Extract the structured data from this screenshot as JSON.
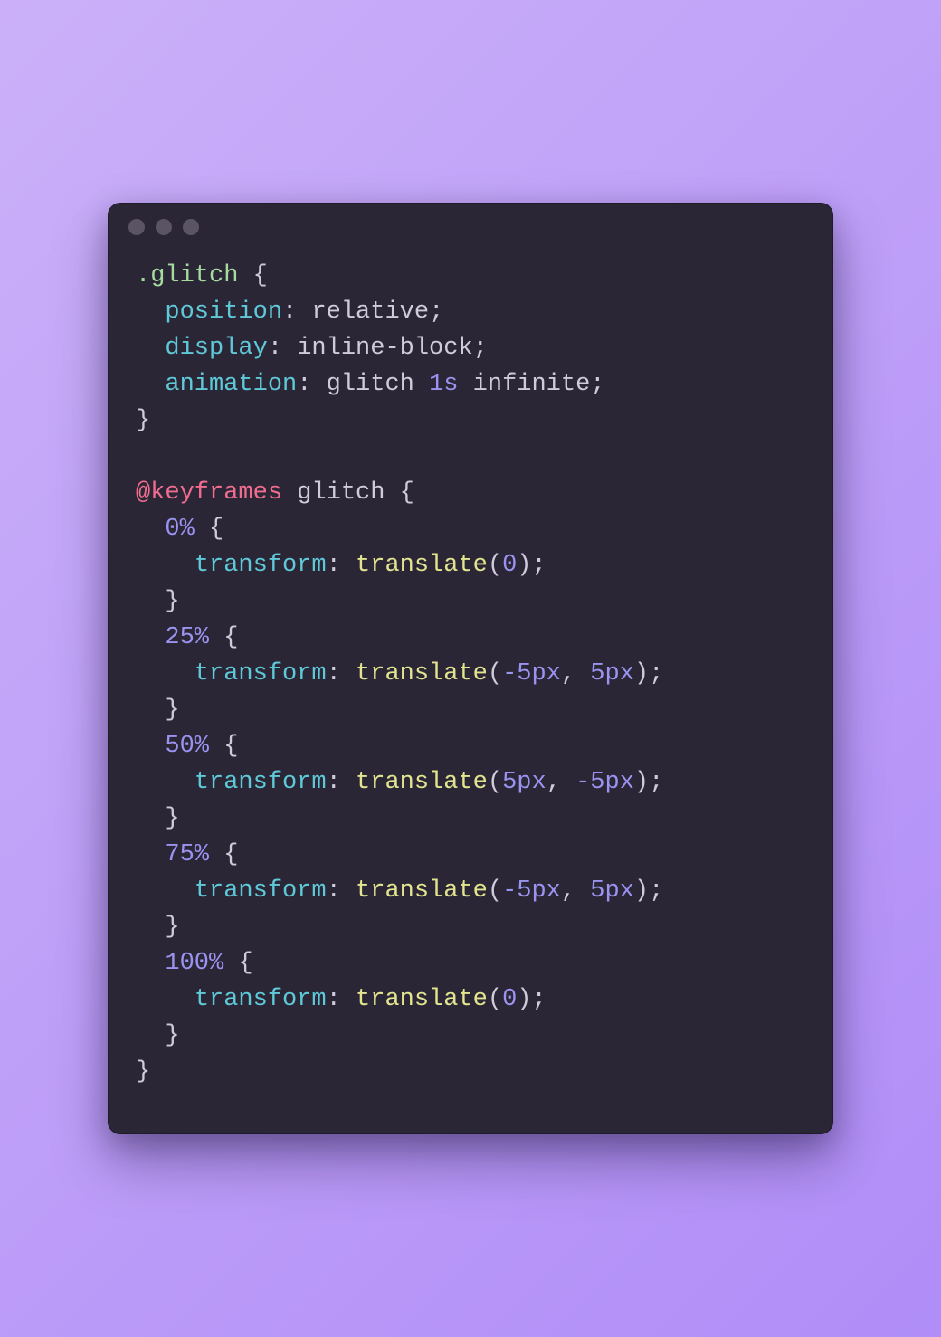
{
  "traffic_lights": [
    "dot",
    "dot",
    "dot"
  ],
  "code": {
    "l1_sel": ".glitch",
    "l1_open": " {",
    "l2_prop": "position",
    "l2_colon": ": ",
    "l2_val": "relative",
    "l2_semi": ";",
    "l3_prop": "display",
    "l3_colon": ": ",
    "l3_val": "inline-block",
    "l3_semi": ";",
    "l4_prop": "animation",
    "l4_colon": ": ",
    "l4_name": "glitch ",
    "l4_dur": "1s",
    "l4_sp": " ",
    "l4_inf": "infinite",
    "l4_semi": ";",
    "l5_close": "}",
    "l7_at": "@keyframes",
    "l7_sp": " ",
    "l7_name": "glitch",
    "l7_open": " {",
    "kf": [
      {
        "pct": "0%",
        "open": " {",
        "prop": "transform",
        "colon": ": ",
        "fn": "translate",
        "lp": "(",
        "args": [
          {
            "n": "0"
          }
        ],
        "rp": ")",
        "semi": ";",
        "close": "}"
      },
      {
        "pct": "25%",
        "open": " {",
        "prop": "transform",
        "colon": ": ",
        "fn": "translate",
        "lp": "(",
        "args": [
          {
            "n": "-5px"
          },
          {
            "c": ", "
          },
          {
            "n": "5px"
          }
        ],
        "rp": ")",
        "semi": ";",
        "close": "}"
      },
      {
        "pct": "50%",
        "open": " {",
        "prop": "transform",
        "colon": ": ",
        "fn": "translate",
        "lp": "(",
        "args": [
          {
            "n": "5px"
          },
          {
            "c": ", "
          },
          {
            "n": "-5px"
          }
        ],
        "rp": ")",
        "semi": ";",
        "close": "}"
      },
      {
        "pct": "75%",
        "open": " {",
        "prop": "transform",
        "colon": ": ",
        "fn": "translate",
        "lp": "(",
        "args": [
          {
            "n": "-5px"
          },
          {
            "c": ", "
          },
          {
            "n": "5px"
          }
        ],
        "rp": ")",
        "semi": ";",
        "close": "}"
      },
      {
        "pct": "100%",
        "open": " {",
        "prop": "transform",
        "colon": ": ",
        "fn": "translate",
        "lp": "(",
        "args": [
          {
            "n": "0"
          }
        ],
        "rp": ")",
        "semi": ";",
        "close": "}"
      }
    ],
    "l_end": "}"
  }
}
